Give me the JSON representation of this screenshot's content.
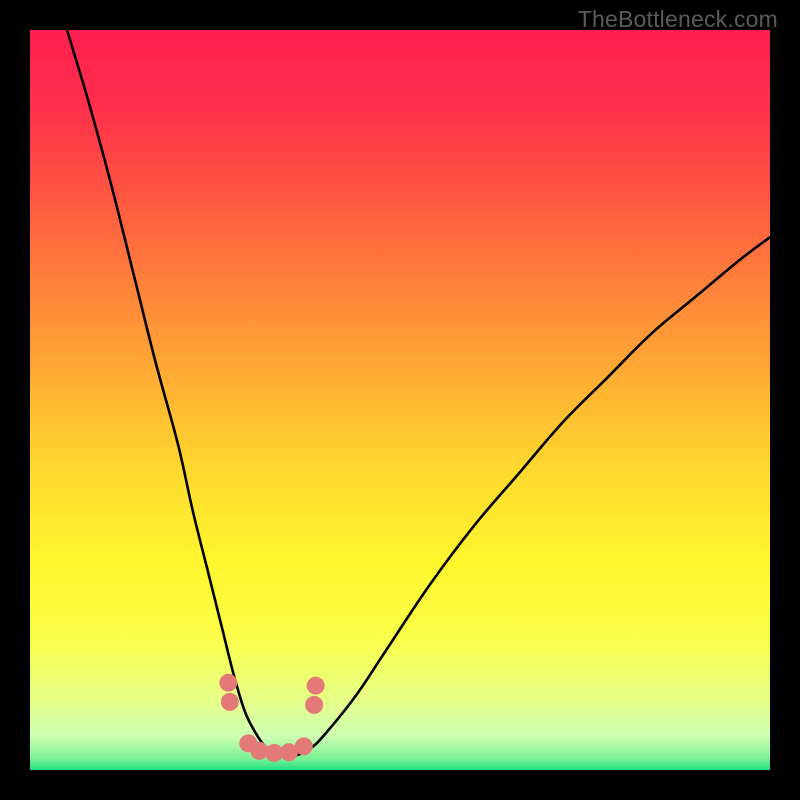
{
  "watermark": "TheBottleneck.com",
  "chart_data": {
    "type": "line",
    "title": "",
    "xlabel": "",
    "ylabel": "",
    "xlim": [
      0,
      100
    ],
    "ylim": [
      0,
      100
    ],
    "gradient_stops": [
      {
        "offset": 0.0,
        "color": "#ff1f51"
      },
      {
        "offset": 0.1,
        "color": "#ff2e4c"
      },
      {
        "offset": 0.22,
        "color": "#ff5542"
      },
      {
        "offset": 0.35,
        "color": "#ff833a"
      },
      {
        "offset": 0.48,
        "color": "#ffb133"
      },
      {
        "offset": 0.6,
        "color": "#ffda2f"
      },
      {
        "offset": 0.72,
        "color": "#fff62e"
      },
      {
        "offset": 0.82,
        "color": "#fbff49"
      },
      {
        "offset": 0.9,
        "color": "#e7ff83"
      },
      {
        "offset": 0.955,
        "color": "#cdffb3"
      },
      {
        "offset": 0.985,
        "color": "#7af094"
      },
      {
        "offset": 1.0,
        "color": "#1ee083"
      }
    ],
    "series": [
      {
        "name": "bottleneck-curve",
        "x": [
          5,
          8,
          11,
          14,
          17,
          20,
          22,
          24,
          26,
          27.5,
          29,
          30.5,
          32,
          34,
          36,
          38,
          40,
          44,
          48,
          54,
          60,
          66,
          72,
          78,
          84,
          90,
          96,
          100
        ],
        "values": [
          100,
          90,
          79,
          67,
          55,
          44,
          35,
          27,
          19,
          13,
          8,
          5,
          3,
          2,
          2,
          3,
          5,
          10,
          16,
          25,
          33,
          40,
          47,
          53,
          59,
          64,
          69,
          72
        ]
      }
    ],
    "markers": {
      "name": "valley-dots",
      "color": "#e47a77",
      "radius": 9,
      "x": [
        26.8,
        27.0,
        29.5,
        31.0,
        33.0,
        35.0,
        37.0,
        38.4,
        38.6
      ],
      "values": [
        11.8,
        9.2,
        3.6,
        2.6,
        2.3,
        2.4,
        3.2,
        8.8,
        11.4
      ]
    }
  }
}
